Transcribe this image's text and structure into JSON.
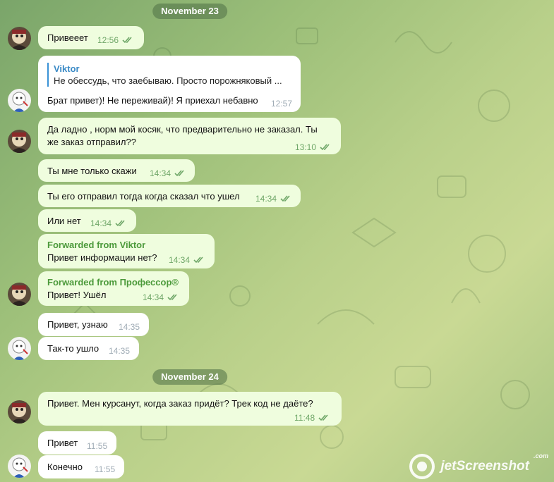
{
  "dates": [
    "November 23",
    "November 24"
  ],
  "messages": [
    {
      "text": "Привееет",
      "time": "12:56"
    },
    {
      "reply_name": "Viktor",
      "reply_text": "Не обессудь, что заебываю. Просто порожняковый ...",
      "text": "Брат привет)! Не переживай)! Я приехал небавно",
      "time": "12:57"
    },
    {
      "text": "Да ладно , норм мой косяк, что предварительно не заказал. Ты же заказ отправил??",
      "time": "13:10"
    },
    {
      "text": "Ты мне только скажи",
      "time": "14:34"
    },
    {
      "text": "Ты его отправил тогда когда сказал что ушел",
      "time": "14:34"
    },
    {
      "text": "Или нет",
      "time": "14:34"
    },
    {
      "forward": "Forwarded from Viktor",
      "text": "Привет информации нет?",
      "time": "14:34"
    },
    {
      "forward": "Forwarded from Профессор®",
      "text": "Привет! Ушёл",
      "time": "14:34"
    },
    {
      "text": "Привет, узнаю",
      "time": "14:35"
    },
    {
      "text": "Так-то ушло",
      "time": "14:35"
    },
    {
      "text": "Привет.  Мен курсанут, когда заказ придёт? Трек код не даёте?",
      "time": "11:48"
    },
    {
      "text": "Привет",
      "time": "11:55"
    },
    {
      "text": "Конечно",
      "time": "11:55"
    }
  ],
  "watermark": {
    "text": "jetScreenshot",
    "suffix": ".com"
  },
  "colors": {
    "outgoing_bubble": "#effdde",
    "incoming_bubble": "#ffffff",
    "accent_green": "#4c9a3b",
    "reply_blue": "#3a92d6"
  }
}
